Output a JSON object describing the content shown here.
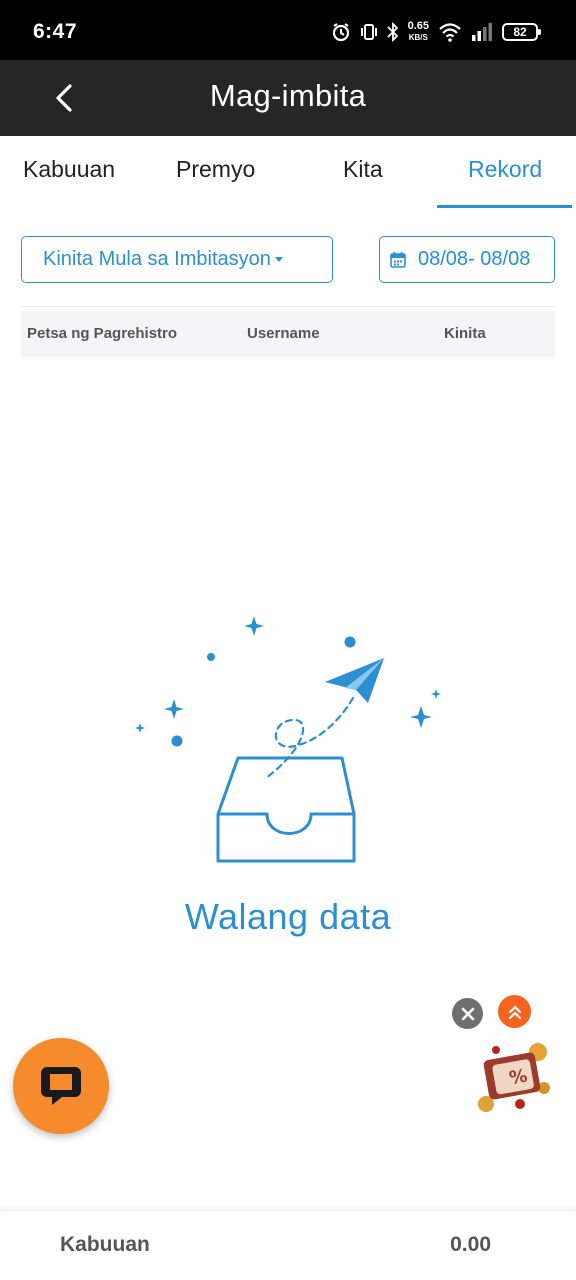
{
  "status_bar": {
    "time": "6:47",
    "net_speed": "0.65",
    "net_unit": "KB/S",
    "battery": "82"
  },
  "header": {
    "title": "Mag-imbita"
  },
  "tabs": [
    {
      "label": "Kabuuan",
      "active": false
    },
    {
      "label": "Premyo",
      "active": false
    },
    {
      "label": "Kita",
      "active": false
    },
    {
      "label": "Rekord",
      "active": true
    }
  ],
  "filters": {
    "type_select": "Kinita Mula sa Imbitasyon",
    "date_range": "08/08- 08/08"
  },
  "table": {
    "columns": [
      "Petsa ng Pagrehistro",
      "Username",
      "Kinita"
    ],
    "rows": []
  },
  "empty_state": {
    "text": "Walang data"
  },
  "footer": {
    "label": "Kabuuan",
    "value": "0.00"
  },
  "colors": {
    "accent": "#2b8fd1",
    "header_bg": "#262626",
    "chat_button": "#f58b2c",
    "scroll_top": "#f5631f"
  },
  "icons": {
    "back": "chevron-left-icon",
    "calendar": "calendar-icon",
    "chat": "chat-bubble-icon",
    "close": "close-icon",
    "scroll_top": "double-chevron-up-icon",
    "promo": "gift-discount-icon"
  }
}
